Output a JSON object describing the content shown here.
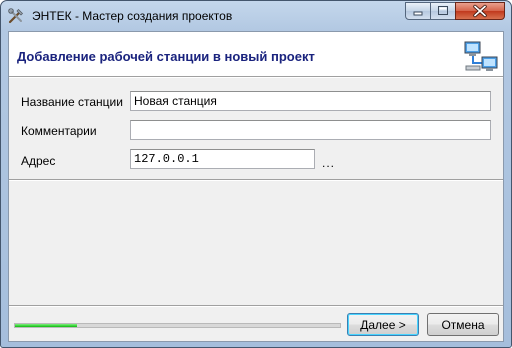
{
  "window": {
    "title": "ЭНТЕК - Мастер создания проектов",
    "icon": "tools-icon"
  },
  "header": {
    "title": "Добавление рабочей станции в новый проект",
    "icon": "network-computers-icon"
  },
  "form": {
    "station_name": {
      "label": "Название станции",
      "value": "Новая станция"
    },
    "comments": {
      "label": "Комментарии",
      "value": ""
    },
    "address": {
      "label": "Адрес",
      "value": "127.0.0.1",
      "browse_label": "..."
    }
  },
  "footer": {
    "progress": 0.19,
    "next_label": "Далее >",
    "cancel_label": "Отмена"
  },
  "colors": {
    "header_title": "#1a237e",
    "progress_fill": "#0dbb0d",
    "title_bar": "#b2c8e2"
  }
}
